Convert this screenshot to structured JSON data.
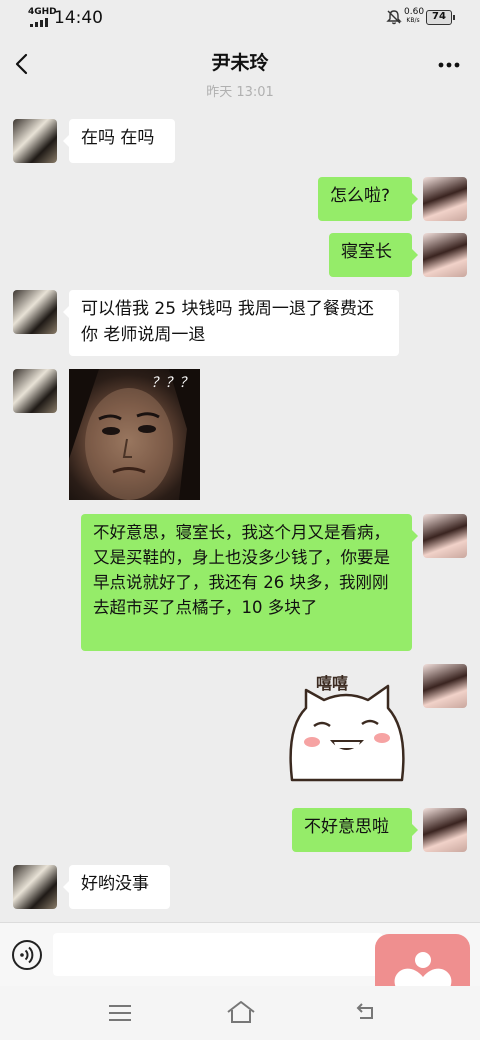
{
  "status_bar": {
    "network": "4GHD",
    "time": "14:40",
    "speed_value": "0.60",
    "speed_unit": "KB/s",
    "battery": "74",
    "icons": [
      "signal-icon",
      "mute-icon",
      "battery-icon"
    ]
  },
  "header": {
    "title": "尹未玲",
    "back_icon": "chevron-left-icon",
    "more_icon": "more-icon"
  },
  "chat": {
    "timestamp": "昨天 13:01",
    "messages": [
      {
        "side": "left",
        "type": "text",
        "text": "在吗 在吗"
      },
      {
        "side": "right",
        "type": "text",
        "text": "怎么啦?"
      },
      {
        "side": "right",
        "type": "text",
        "text": "寝室长"
      },
      {
        "side": "left",
        "type": "text",
        "text": "可以借我 25 块钱吗  我周一退了餐费还你  老师说周一退"
      },
      {
        "side": "left",
        "type": "image",
        "marks": "？？？"
      },
      {
        "side": "right",
        "type": "text",
        "text": "不好意思，寝室长，我这个月又是看病，又是买鞋的，身上也没多少钱了，你要是早点说就好了，我还有 26 块多，我刚刚去超市买了点橘子，10 多块了"
      },
      {
        "side": "right",
        "type": "sticker",
        "caption": "嘻嘻"
      },
      {
        "side": "right",
        "type": "text",
        "text": "不好意思啦"
      },
      {
        "side": "left",
        "type": "text",
        "text": "好哟没事"
      }
    ]
  },
  "input_bar": {
    "voice_icon": "voice-icon",
    "value": "",
    "placeholder": ""
  },
  "floating_app": {
    "icon": "heart-icon",
    "color": "#ef8f8f"
  },
  "system_nav": {
    "icons": [
      "menu-icon",
      "home-icon",
      "back-icon"
    ]
  },
  "colors": {
    "background": "#ededed",
    "bubble_self": "#95ec69",
    "bubble_other": "#ffffff",
    "timestamp": "#b0b0b0"
  }
}
